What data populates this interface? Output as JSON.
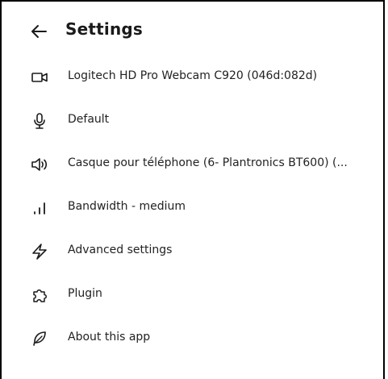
{
  "header": {
    "title": "Settings",
    "back_icon": "arrow-left-icon"
  },
  "menu": {
    "items": [
      {
        "label": "Logitech HD Pro Webcam C920 (046d:082d)",
        "icon": "video-camera-icon"
      },
      {
        "label": "Default",
        "icon": "microphone-icon"
      },
      {
        "label": "Casque pour téléphone (6- Plantronics BT600) (...",
        "icon": "speaker-icon"
      },
      {
        "label": "Bandwidth - medium",
        "icon": "signal-bars-icon"
      },
      {
        "label": "Advanced settings",
        "icon": "lightning-icon"
      },
      {
        "label": "Plugin",
        "icon": "puzzle-icon"
      },
      {
        "label": "About this app",
        "icon": "feather-icon"
      }
    ]
  }
}
